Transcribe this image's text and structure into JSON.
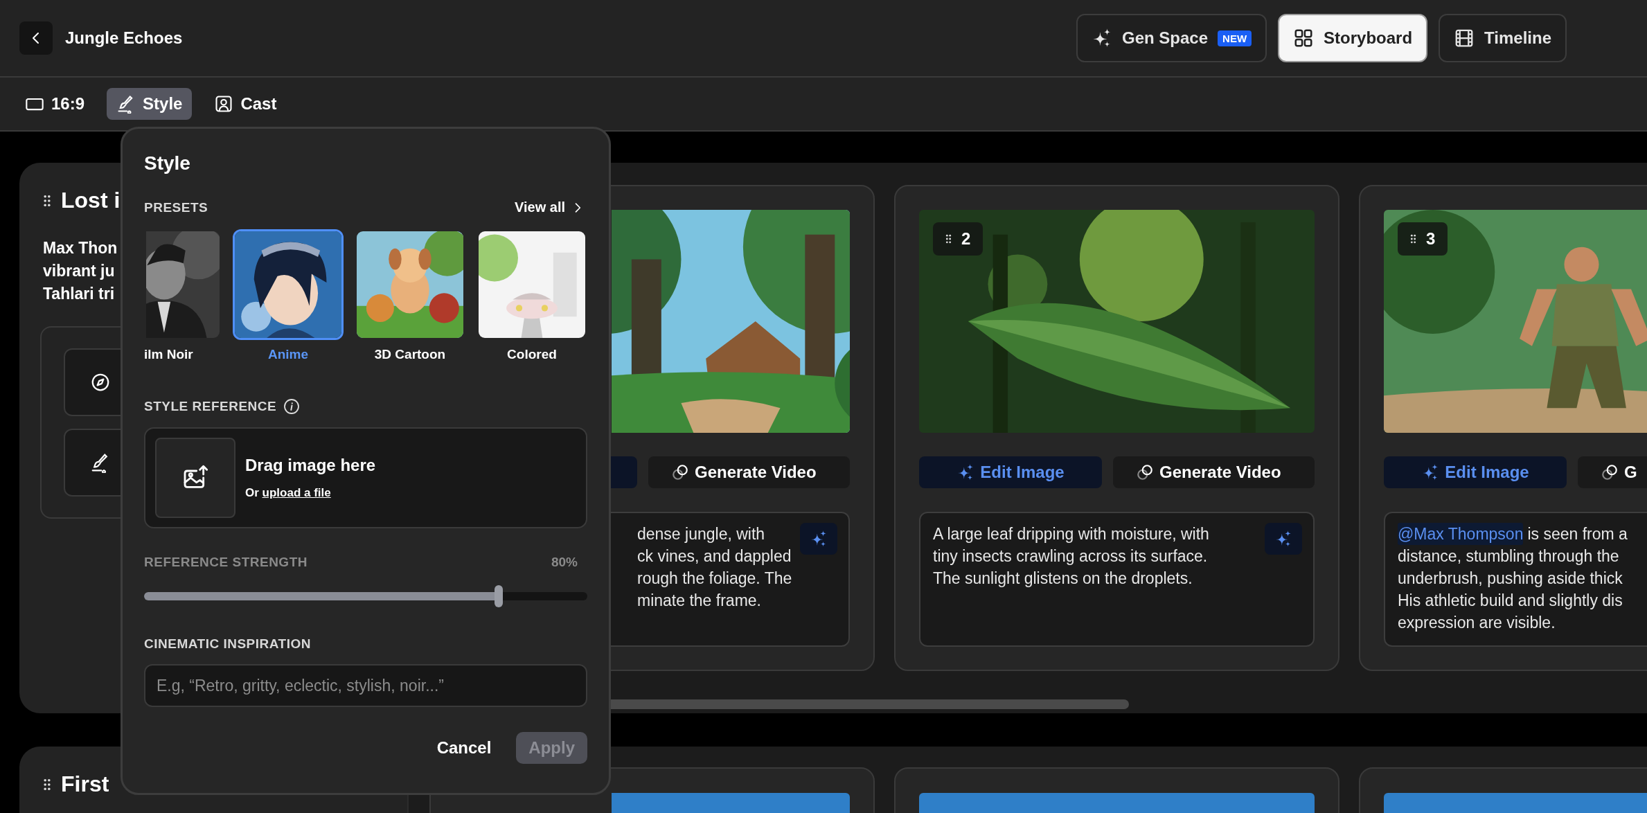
{
  "header": {
    "title": "Jungle Echoes",
    "views": [
      {
        "label": "Gen Space",
        "badge": "NEW",
        "kind": "gen",
        "selected": false
      },
      {
        "label": "Storyboard",
        "kind": "storyboard",
        "selected": true
      },
      {
        "label": "Timeline",
        "kind": "timeline",
        "selected": false
      }
    ]
  },
  "toolbar": [
    {
      "label": "16:9",
      "kind": "aspect",
      "selected": false
    },
    {
      "label": "Style",
      "kind": "style",
      "selected": true
    },
    {
      "label": "Cast",
      "kind": "cast",
      "selected": false
    }
  ],
  "scenes": [
    {
      "title": "Lost i",
      "description_lines": [
        "Max Thon",
        "vibrant ju",
        "Tahlari tri"
      ],
      "tools": [
        {
          "kind": "compass"
        },
        {
          "kind": "brush"
        }
      ],
      "shots": [
        {
          "kind": "picture",
          "video_label": "Generate Video",
          "assist": true,
          "lines": [
            "dense jungle, with",
            "ck vines, and dappled",
            "rough the foliage. The",
            "minate the frame."
          ]
        },
        {
          "kind": "picture",
          "number": "2",
          "edit_label": "Edit Image",
          "video_label": "Generate Video",
          "assist": true,
          "text": "A large leaf dripping with moisture, with tiny insects crawling across its surface. The sunlight glistens on the droplets."
        },
        {
          "kind": "picture",
          "number": "3",
          "edit_label": "Edit Image",
          "video_label": "G",
          "mention": "@Max Thompson",
          "lines": [
            "is seen from a",
            "distance, stumbling through the",
            "underbrush, pushing aside thick",
            "His athletic build and slightly dis",
            "expression are visible."
          ]
        }
      ]
    },
    {
      "title": "First"
    }
  ],
  "style_panel": {
    "title": "Style",
    "presets_label": "PRESETS",
    "view_all": "View all",
    "presets": [
      {
        "label": "ilm Noir",
        "selected": false
      },
      {
        "label": "Anime",
        "selected": true
      },
      {
        "label": "3D Cartoon",
        "selected": false
      },
      {
        "label": "Colored",
        "selected": false
      }
    ],
    "reference_label": "STYLE REFERENCE",
    "drop_title": "Drag image here",
    "drop_prefix": "Or",
    "drop_link": "upload a file",
    "strength_label": "REFERENCE STRENGTH",
    "strength_value": "80%",
    "strength": {
      "level": 0.8
    },
    "inspiration_label": "CINEMATIC INSPIRATION",
    "inspiration": {
      "placeholder": "E.g, “Retro, gritty, eclectic, stylish, noir...”"
    },
    "buttons": [
      {
        "label": "Cancel",
        "kind": "text",
        "disabled": false
      },
      {
        "label": "Apply",
        "kind": "primary",
        "disabled": true
      }
    ]
  }
}
